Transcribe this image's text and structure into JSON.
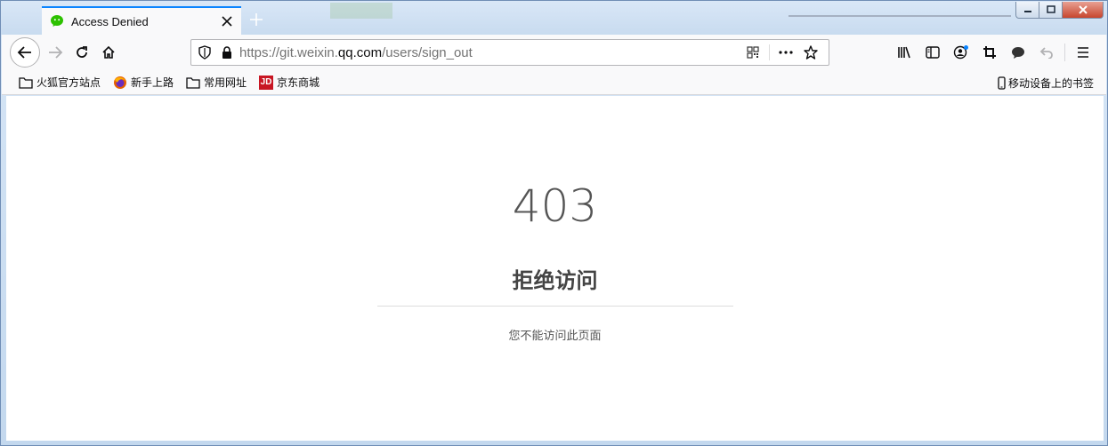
{
  "tab": {
    "title": "Access Denied",
    "favicon": "wechat-icon",
    "accent": "#0a84ff"
  },
  "url": {
    "prefix": "https://git.weixin.",
    "host": "qq.com",
    "path": "/users/sign_out"
  },
  "bookmarks": [
    {
      "label": "火狐官方站点",
      "icon": "folder-icon"
    },
    {
      "label": "新手上路",
      "icon": "firefox-icon"
    },
    {
      "label": "常用网址",
      "icon": "folder-icon"
    },
    {
      "label": "京东商城",
      "icon": "jd-icon"
    }
  ],
  "mobile_bookmarks": "移动设备上的书签",
  "jd_icon_text": "JD",
  "page": {
    "code": "403",
    "title": "拒绝访问",
    "description": "您不能访问此页面"
  },
  "colors": {
    "wechat": "#2dc100",
    "jd": "#c81623"
  }
}
